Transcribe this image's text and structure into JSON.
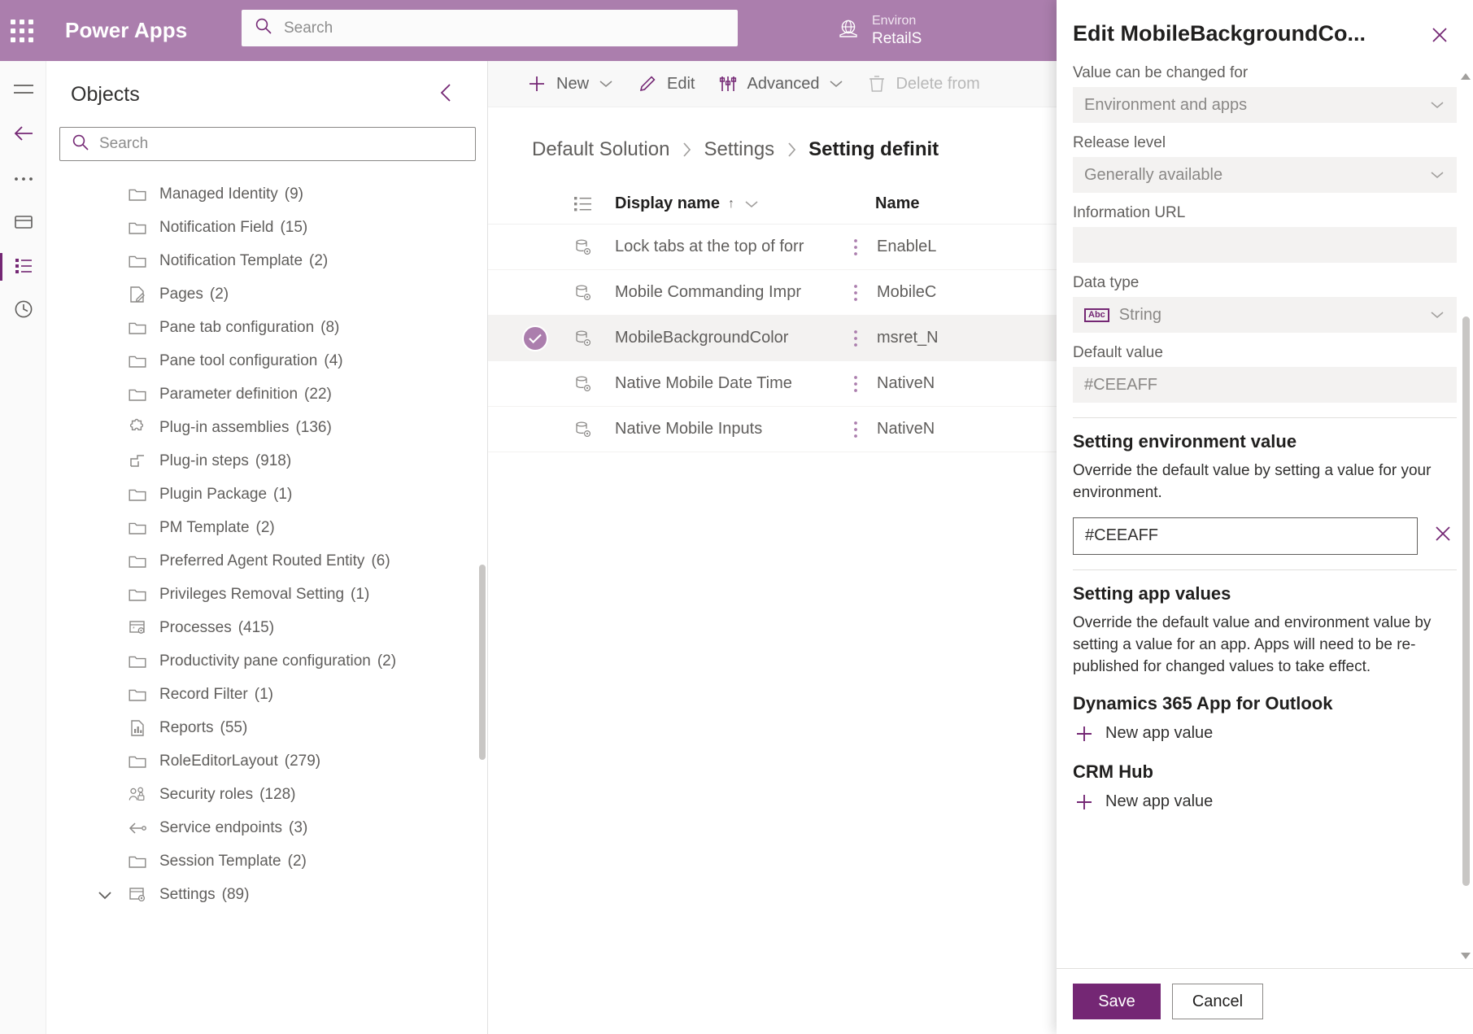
{
  "topbar": {
    "waffle_icon": "waffle-grid-icon",
    "brand": "Power Apps",
    "search_placeholder": "Search",
    "search_value": "",
    "search_icon": "search-icon",
    "globe_icon": "globe-icon",
    "environment_label": "Environ",
    "environment_name": "RetailS"
  },
  "rail": {
    "hamburger_icon": "hamburger-icon",
    "back_icon": "back-arrow-icon",
    "overflow_icon": "ellipsis-icon",
    "solutions_icon": "solutions-icon",
    "objects_icon": "objects-list-icon",
    "history_icon": "history-clock-icon"
  },
  "objects_panel": {
    "title": "Objects",
    "collapse_icon": "chevron-left-icon",
    "search_placeholder": "Search",
    "search_value": "",
    "search_icon": "search-icon",
    "items": [
      {
        "label": "Managed Identity",
        "count": "(9)",
        "icon": "folder-icon"
      },
      {
        "label": "Notification Field",
        "count": "(15)",
        "icon": "folder-icon"
      },
      {
        "label": "Notification Template",
        "count": "(2)",
        "icon": "folder-icon"
      },
      {
        "label": "Pages",
        "count": "(2)",
        "icon": "page-edit-icon"
      },
      {
        "label": "Pane tab configuration",
        "count": "(8)",
        "icon": "folder-icon"
      },
      {
        "label": "Pane tool configuration",
        "count": "(4)",
        "icon": "folder-icon"
      },
      {
        "label": "Parameter definition",
        "count": "(22)",
        "icon": "folder-icon"
      },
      {
        "label": "Plug-in assemblies",
        "count": "(136)",
        "icon": "puzzle-icon"
      },
      {
        "label": "Plug-in steps",
        "count": "(918)",
        "icon": "plugin-step-icon"
      },
      {
        "label": "Plugin Package",
        "count": "(1)",
        "icon": "folder-icon"
      },
      {
        "label": "PM Template",
        "count": "(2)",
        "icon": "folder-icon"
      },
      {
        "label": "Preferred Agent Routed Entity",
        "count": "(6)",
        "icon": "folder-icon"
      },
      {
        "label": "Privileges Removal Setting",
        "count": "(1)",
        "icon": "folder-icon"
      },
      {
        "label": "Processes",
        "count": "(415)",
        "icon": "process-icon"
      },
      {
        "label": "Productivity pane configuration",
        "count": "(2)",
        "icon": "folder-icon"
      },
      {
        "label": "Record Filter",
        "count": "(1)",
        "icon": "folder-icon"
      },
      {
        "label": "Reports",
        "count": "(55)",
        "icon": "report-chart-icon"
      },
      {
        "label": "RoleEditorLayout",
        "count": "(279)",
        "icon": "folder-icon"
      },
      {
        "label": "Security roles",
        "count": "(128)",
        "icon": "people-lock-icon"
      },
      {
        "label": "Service endpoints",
        "count": "(3)",
        "icon": "endpoint-icon"
      },
      {
        "label": "Session Template",
        "count": "(2)",
        "icon": "folder-icon"
      }
    ],
    "expandable_item": {
      "label": "Settings",
      "count": "(89)",
      "icon": "settings-table-icon",
      "chevron": "chevron-down-icon"
    }
  },
  "command_bar": {
    "new": {
      "label": "New",
      "icon": "plus-icon",
      "chevron": "chevron-down-icon"
    },
    "edit": {
      "label": "Edit",
      "icon": "pencil-icon"
    },
    "advanced": {
      "label": "Advanced",
      "icon": "tools-icon",
      "chevron": "chevron-down-icon"
    },
    "delete": {
      "label": "Delete from",
      "icon": "trash-icon"
    }
  },
  "breadcrumb": {
    "root": "Default Solution",
    "level2": "Settings",
    "current": "Setting definit",
    "separator_icon": "chevron-right-icon"
  },
  "table": {
    "list_icon": "list-view-icon",
    "columns": {
      "display_name": "Display name",
      "sort_indicator": "↑",
      "sort_chevron_icon": "chevron-down-icon",
      "name": "Name"
    },
    "rows": [
      {
        "display_name": "Lock tabs at the top of forr",
        "name": "EnableL",
        "icon": "setting-definition-icon",
        "kebab_icon": "more-vertical-icon",
        "selected": false
      },
      {
        "display_name": "Mobile Commanding Impr",
        "name": "MobileC",
        "icon": "setting-definition-icon",
        "kebab_icon": "more-vertical-icon",
        "selected": false
      },
      {
        "display_name": "MobileBackgroundColor",
        "name": "msret_N",
        "icon": "setting-definition-icon",
        "kebab_icon": "more-vertical-icon",
        "selected": true
      },
      {
        "display_name": "Native Mobile Date Time",
        "name": "NativeN",
        "icon": "setting-definition-icon",
        "kebab_icon": "more-vertical-icon",
        "selected": false
      },
      {
        "display_name": "Native Mobile Inputs",
        "name": "NativeN",
        "icon": "setting-definition-icon",
        "kebab_icon": "more-vertical-icon",
        "selected": false
      }
    ]
  },
  "panel": {
    "title": "Edit MobileBackgroundCo...",
    "close_icon": "close-icon",
    "fields": {
      "value_changed_for_label": "Value can be changed for",
      "value_changed_for_value": "Environment and apps",
      "release_level_label": "Release level",
      "release_level_value": "Generally available",
      "information_url_label": "Information URL",
      "information_url_value": "",
      "data_type_label": "Data type",
      "data_type_value": "String",
      "data_type_badge": "Abc",
      "default_value_label": "Default value",
      "default_value": "#CEEAFF",
      "dropdown_icon": "chevron-down-icon"
    },
    "environment_section": {
      "title": "Setting environment value",
      "description": "Override the default value by setting a value for your environment.",
      "value": "#CEEAFF",
      "clear_icon": "close-icon"
    },
    "app_section": {
      "title": "Setting app values",
      "description": "Override the default value and environment value by setting a value for an app. Apps will need to be re-published for changed values to take effect.",
      "apps": [
        {
          "name": "Dynamics 365 App for Outlook",
          "action": "New app value",
          "action_icon": "plus-icon"
        },
        {
          "name": "CRM Hub",
          "action": "New app value",
          "action_icon": "plus-icon"
        }
      ]
    },
    "footer": {
      "save": "Save",
      "cancel": "Cancel"
    }
  },
  "colors": {
    "brand_bar": "#ab7ead",
    "accent": "#742774",
    "selection": "#ab7ead",
    "panel_bg": "#ffffff"
  }
}
